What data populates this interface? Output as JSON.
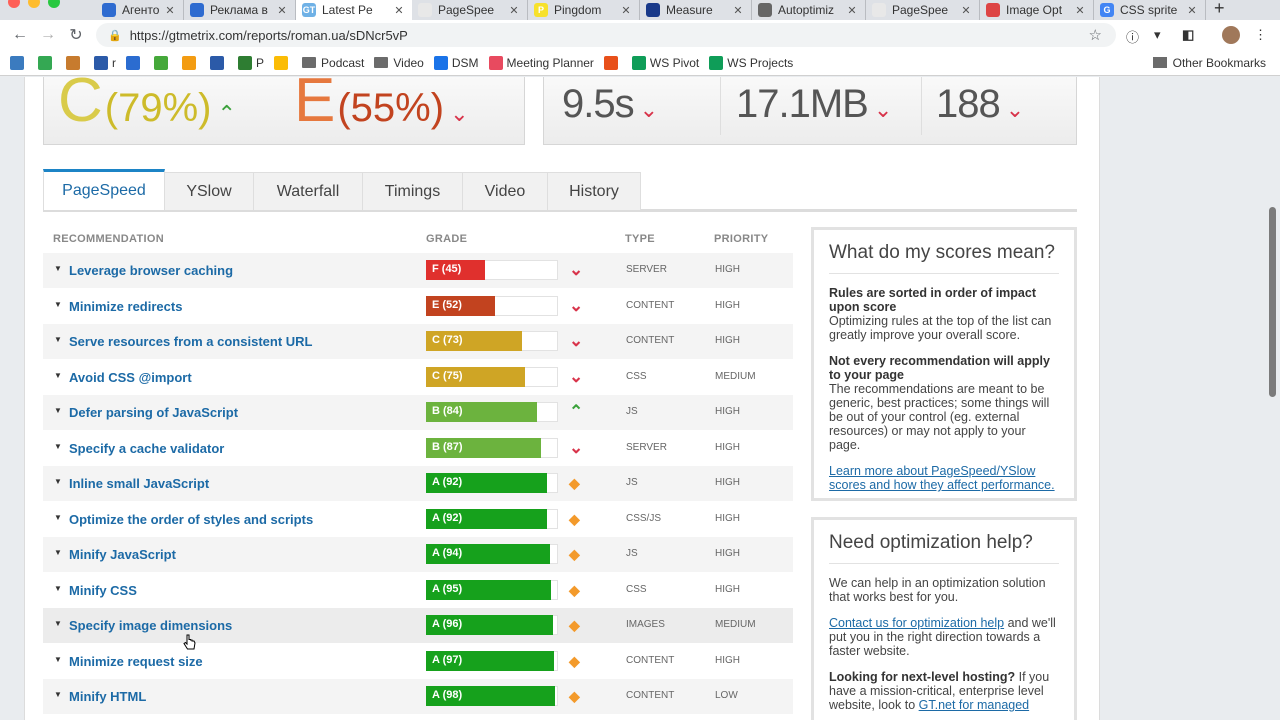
{
  "browser": {
    "tabs": [
      {
        "label": "Агенто",
        "color": "#2e6bd0",
        "glyph": ""
      },
      {
        "label": "Реклама в",
        "color": "#2e6bd0",
        "glyph": ""
      },
      {
        "label": "Latest Pe",
        "color": "#6fb1e6",
        "glyph": "GT",
        "active": true
      },
      {
        "label": "PageSpee",
        "color": "#e8e8e8",
        "glyph": ""
      },
      {
        "label": "Pingdom",
        "color": "#f7e12b",
        "glyph": "P"
      },
      {
        "label": "Measure",
        "color": "#1a3a8a",
        "glyph": ""
      },
      {
        "label": "Autoptimiz",
        "color": "#666666",
        "glyph": ""
      },
      {
        "label": "PageSpee",
        "color": "#e8e8e8",
        "glyph": ""
      },
      {
        "label": "Image Opt",
        "color": "#d44",
        "glyph": ""
      },
      {
        "label": "CSS sprite",
        "color": "#4285f4",
        "glyph": "G"
      }
    ],
    "url": "https://gtmetrix.com/reports/roman.ua/sDNcr5vP",
    "bookmarks": [
      {
        "label": "",
        "type": "icon",
        "color": "#3b7bbf"
      },
      {
        "label": "",
        "type": "icon",
        "color": "#34a853"
      },
      {
        "label": "",
        "type": "icon",
        "color": "#c77b2e"
      },
      {
        "label": "r",
        "type": "icon",
        "color": "#2b5aa8"
      },
      {
        "label": "",
        "type": "icon",
        "color": "#2b6cd0"
      },
      {
        "label": "",
        "type": "icon",
        "color": "#45a83a"
      },
      {
        "label": "",
        "type": "icon",
        "color": "#f39c12"
      },
      {
        "label": "",
        "type": "icon",
        "color": "#2b5aa8"
      },
      {
        "label": "P",
        "type": "icon",
        "color": "#2e7d32"
      },
      {
        "label": "",
        "type": "icon",
        "color": "#fbbc05"
      },
      {
        "label": "Podcast",
        "type": "folder"
      },
      {
        "label": "Video",
        "type": "folder"
      },
      {
        "label": "DSM",
        "type": "icon",
        "color": "#1a73e8"
      },
      {
        "label": "Meeting Planner",
        "type": "icon",
        "color": "#e84a5f"
      },
      {
        "label": "",
        "type": "icon",
        "color": "#e8501a"
      },
      {
        "label": "WS Pivot",
        "type": "icon",
        "color": "#0f9d58"
      },
      {
        "label": "WS Projects",
        "type": "icon",
        "color": "#0f9d58"
      }
    ],
    "other_bookmarks": "Other Bookmarks"
  },
  "scores": {
    "pagespeed_grade": "C",
    "pagespeed_pct": "(79%)",
    "yslow_grade": "E",
    "yslow_pct": "(55%)",
    "load_time": "9.5s",
    "page_size": "17.1MB",
    "requests": "188"
  },
  "report_tabs": [
    "PageSpeed",
    "YSlow",
    "Waterfall",
    "Timings",
    "Video",
    "History"
  ],
  "table": {
    "headers": {
      "recommendation": "RECOMMENDATION",
      "grade": "GRADE",
      "type": "TYPE",
      "priority": "PRIORITY"
    },
    "rows": [
      {
        "name": "Leverage browser caching",
        "grade": "F (45)",
        "score": 45,
        "color": "#e0302d",
        "trend": "down",
        "type": "SERVER",
        "priority": "HIGH"
      },
      {
        "name": "Minimize redirects",
        "grade": "E (52)",
        "score": 52,
        "color": "#c2431f",
        "trend": "down",
        "type": "CONTENT",
        "priority": "HIGH"
      },
      {
        "name": "Serve resources from a consistent URL",
        "grade": "C (73)",
        "score": 73,
        "color": "#cfa525",
        "trend": "down",
        "type": "CONTENT",
        "priority": "HIGH"
      },
      {
        "name": "Avoid CSS @import",
        "grade": "C (75)",
        "score": 75,
        "color": "#cfa525",
        "trend": "down",
        "type": "CSS",
        "priority": "MEDIUM"
      },
      {
        "name": "Defer parsing of JavaScript",
        "grade": "B (84)",
        "score": 84,
        "color": "#6cb33e",
        "trend": "up",
        "type": "JS",
        "priority": "HIGH"
      },
      {
        "name": "Specify a cache validator",
        "grade": "B (87)",
        "score": 87,
        "color": "#6cb33e",
        "trend": "down",
        "type": "SERVER",
        "priority": "HIGH"
      },
      {
        "name": "Inline small JavaScript",
        "grade": "A (92)",
        "score": 92,
        "color": "#16a11c",
        "trend": "diamond",
        "type": "JS",
        "priority": "HIGH"
      },
      {
        "name": "Optimize the order of styles and scripts",
        "grade": "A (92)",
        "score": 92,
        "color": "#16a11c",
        "trend": "diamond",
        "type": "CSS/JS",
        "priority": "HIGH"
      },
      {
        "name": "Minify JavaScript",
        "grade": "A (94)",
        "score": 94,
        "color": "#16a11c",
        "trend": "diamond",
        "type": "JS",
        "priority": "HIGH"
      },
      {
        "name": "Minify CSS",
        "grade": "A (95)",
        "score": 95,
        "color": "#16a11c",
        "trend": "diamond",
        "type": "CSS",
        "priority": "HIGH"
      },
      {
        "name": "Specify image dimensions",
        "grade": "A (96)",
        "score": 96,
        "color": "#16a11c",
        "trend": "diamond",
        "type": "IMAGES",
        "priority": "MEDIUM"
      },
      {
        "name": "Minimize request size",
        "grade": "A (97)",
        "score": 97,
        "color": "#16a11c",
        "trend": "diamond",
        "type": "CONTENT",
        "priority": "HIGH"
      },
      {
        "name": "Minify HTML",
        "grade": "A (98)",
        "score": 98,
        "color": "#16a11c",
        "trend": "diamond",
        "type": "CONTENT",
        "priority": "LOW"
      }
    ]
  },
  "sidebar": {
    "scores_panel": {
      "title": "What do my scores mean?",
      "p1_strong": "Rules are sorted in order of impact upon score",
      "p1_text": "Optimizing rules at the top of the list can greatly improve your overall score.",
      "p2_strong": "Not every recommendation will apply to your page",
      "p2_text": "The recommendations are meant to be generic, best practices; some things will be out of your control (eg. external resources) or may not apply to your page.",
      "link": "Learn more about PageSpeed/YSlow scores and how they affect performance."
    },
    "help_panel": {
      "title": "Need optimization help?",
      "p1": "We can help in an optimization solution that works best for you.",
      "link": "Contact us for optimization help",
      "p2_rest": " and we'll put you in the right direction towards a faster website.",
      "p3_strong": "Looking for next-level hosting?",
      "p3_text": " If you have a mission-critical, enterprise level website, look to ",
      "p3_link": "GT.net for managed"
    }
  }
}
